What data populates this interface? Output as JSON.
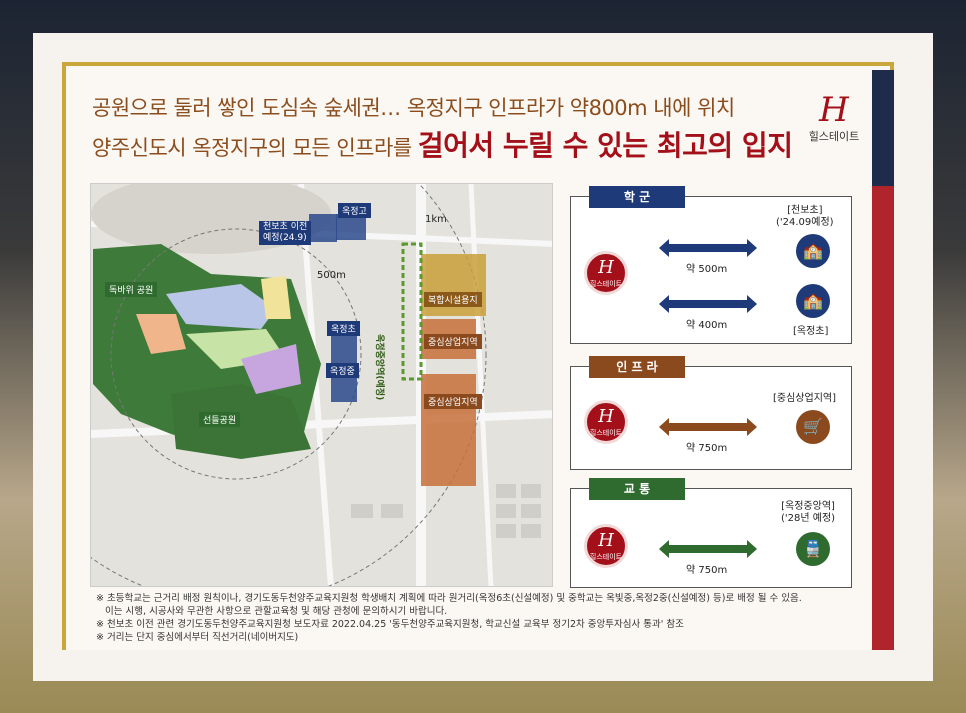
{
  "headline": {
    "line1": "공원으로 둘러 쌓인 도심속 숲세권… 옥정지구 인프라가 약800m 내에 위치",
    "line2_prefix": "양주신도시 옥정지구의 모든 인프라를 ",
    "line2_emphasis": "걸어서 누릴 수 있는 최고의 입지"
  },
  "logo": {
    "mark": "H",
    "text": "힐스테이트"
  },
  "map": {
    "labels": {
      "okjeong_high": "옥정고",
      "cheonbo_relocation": "천보초 이전\n예정(24.9)",
      "park_dokbawi": "독바위 공원",
      "park_seondeul": "선들공원",
      "okjeong_elem": "옥정초",
      "okjeong_middle": "옥정중",
      "complex_site": "복합시설용지",
      "commercial_1": "중심상업지역",
      "commercial_2": "중심상업지역",
      "station": "옥정중앙역(예정)",
      "r1km": "1km",
      "r500m": "500m"
    }
  },
  "panels": {
    "school": {
      "title": "학 군",
      "dest1": "[천보초]\n('24.09예정)",
      "dist1": "약 500m",
      "dest2": "[옥정초]",
      "dist2": "약 400m"
    },
    "infra": {
      "title": "인 프 라",
      "dest1": "[중심상업지역]",
      "dist1": "약 750m"
    },
    "transit": {
      "title": "교 통",
      "dest1": "[옥정중앙역]\n('28년 예정)",
      "dist1": "약 750m"
    }
  },
  "notes": [
    "※ 초등학교는 근거리 배정 원칙이나, 경기도동두천양주교육지원청 학생배치 계획에 따라 원거리(옥정6초(신설예정) 및 중학교는 옥빛중,옥정2중(신설예정) 등)로 배정 될 수 있음.",
    "   이는 시행, 시공사와 무관한 사항으로 관할교육청 및 해당 관청에 문의하시기 바랍니다.",
    "※ 천보초 이전 관련 경기도동두천양주교육지원청 보도자료 2022.04.25 '동두천양주교육지원청, 학교신설 교육부 정기2차 중앙투자심사 통과' 참조",
    "※ 거리는 단지 중심에서부터 직선거리(네이버지도)"
  ],
  "colors": {
    "brand_red": "#a4101a",
    "navy": "#1f3a78",
    "brown": "#8b4d1e",
    "green": "#2f6b2f",
    "gold": "#c9a73a"
  }
}
